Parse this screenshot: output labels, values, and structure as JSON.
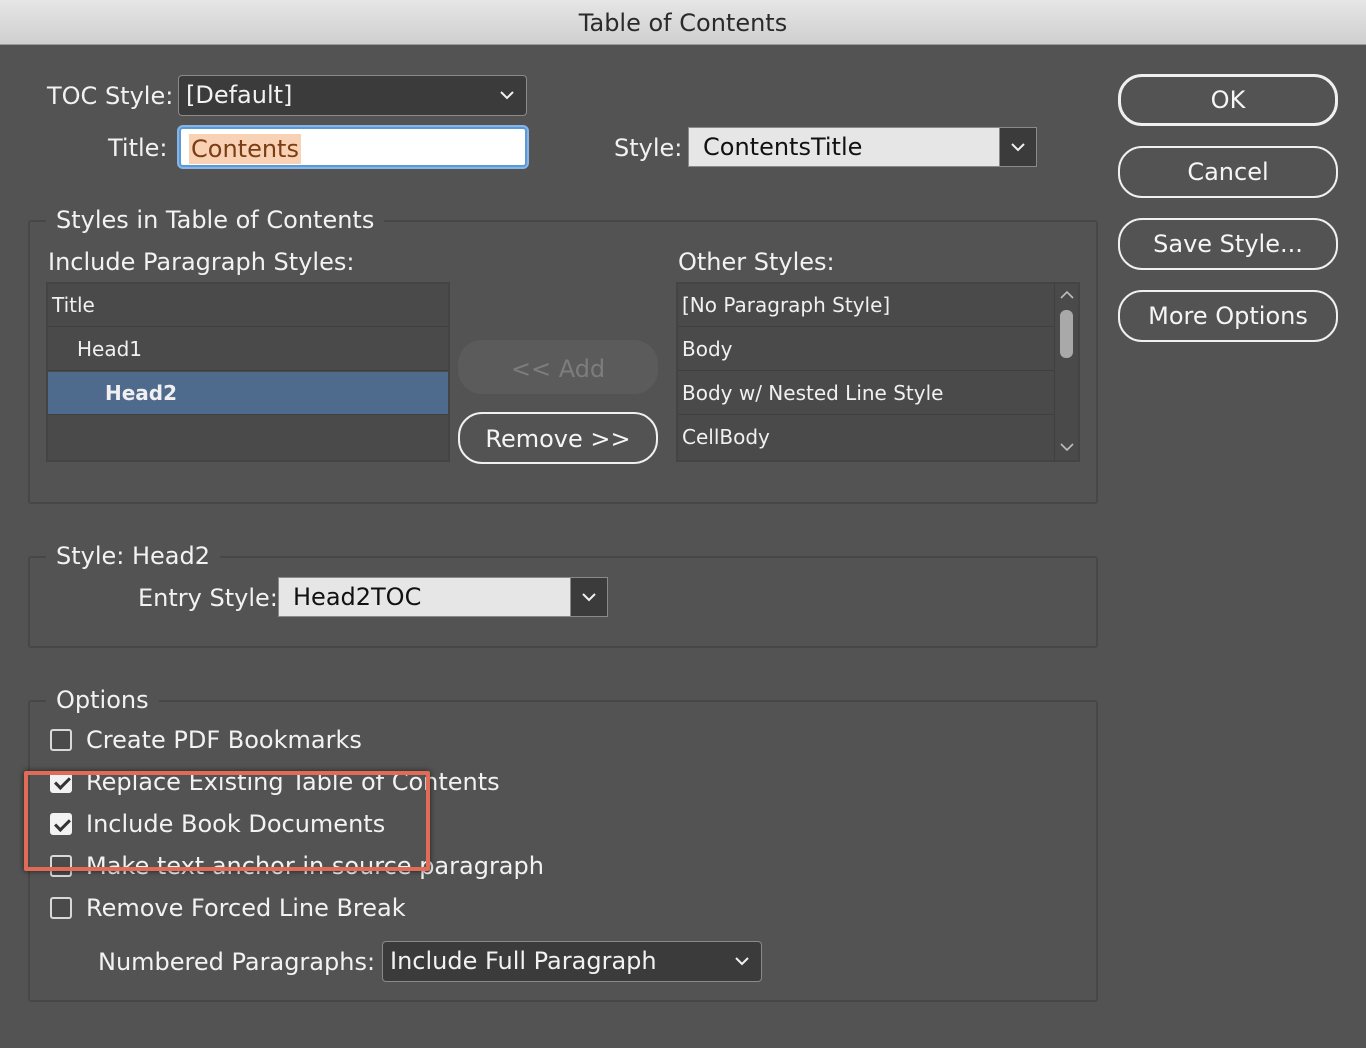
{
  "window": {
    "title": "Table of Contents"
  },
  "toc_style": {
    "label": "TOC Style:",
    "value": "[Default]"
  },
  "title_field": {
    "label": "Title:",
    "value": "Contents"
  },
  "title_style": {
    "label": "Style:",
    "value": "ContentsTitle"
  },
  "styles_group": {
    "legend": "Styles in Table of Contents",
    "include_label": "Include Paragraph Styles:",
    "include_items": [
      "Title",
      "Head1",
      "Head2"
    ],
    "other_label": "Other Styles:",
    "other_items": [
      "[No Paragraph Style]",
      "Body",
      "Body w/ Nested Line Style",
      "CellBody"
    ],
    "add_label": "<< Add",
    "remove_label": "Remove >>"
  },
  "style_group": {
    "legend": "Style: Head2",
    "entry_label": "Entry Style:",
    "entry_value": "Head2TOC"
  },
  "options_group": {
    "legend": "Options",
    "checkboxes": [
      {
        "label": "Create PDF Bookmarks",
        "checked": false
      },
      {
        "label": "Replace Existing Table of Contents",
        "checked": true
      },
      {
        "label": "Include Book Documents",
        "checked": true
      },
      {
        "label": "Make text anchor in source paragraph",
        "checked": false
      },
      {
        "label": "Remove Forced Line Break",
        "checked": false
      }
    ],
    "numbered_label": "Numbered Paragraphs:",
    "numbered_value": "Include Full Paragraph"
  },
  "buttons": {
    "ok": "OK",
    "cancel": "Cancel",
    "save_style": "Save Style...",
    "more_options": "More Options"
  },
  "colors": {
    "highlight": "#e06b56",
    "selection": "#4e6a8c",
    "dialog_bg": "#535353"
  }
}
